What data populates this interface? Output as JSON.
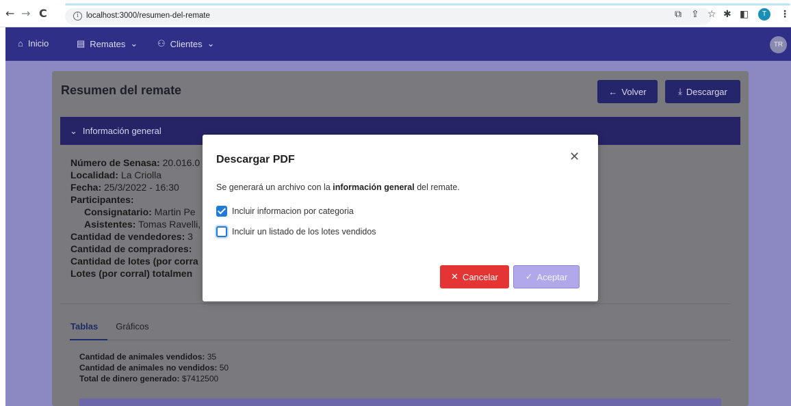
{
  "browser": {
    "url": "localhost:3000/resumen-del-remate",
    "back_icon": "←",
    "forward_icon": "→",
    "reload_icon": "C",
    "profile_initial": "T"
  },
  "navbar": {
    "items": [
      {
        "icon": "⌂",
        "label": "Inicio"
      },
      {
        "icon": "▤",
        "label": "Remates",
        "caret": "⌄"
      },
      {
        "icon": "⚇",
        "label": "Clientes",
        "caret": "⌄"
      }
    ],
    "avatar": "TR"
  },
  "page": {
    "title": "Resumen del remate",
    "back_button": "Volver",
    "download_button": "Descargar",
    "accordion_title": "Información general",
    "info": {
      "senasa_label": "Número de Senasa:",
      "senasa_value": "20.016.0",
      "localidad_label": "Localidad:",
      "localidad_value": "La Criolla",
      "fecha_label": "Fecha:",
      "fecha_value": "25/3/2022 - 16:30",
      "participantes_label": "Participantes:",
      "consignatario_label": "Consignatario:",
      "consignatario_value": "Martin Pe",
      "asistentes_label": "Asistentes:",
      "asistentes_value": "Tomas Ravelli,",
      "vendedores_label": "Cantidad de vendedores:",
      "vendedores_value": "3",
      "compradores_label": "Cantidad de compradores:",
      "compradores_value": "",
      "lotes_label": "Cantidad de lotes (por corra",
      "lotes_total_label": "Lotes (por corral) totalmen"
    },
    "tabs": [
      {
        "label": "Tablas"
      },
      {
        "label": "Gráficos"
      }
    ],
    "stats": {
      "vendidos_label": "Cantidad de animales vendidos:",
      "vendidos_value": "35",
      "no_vendidos_label": "Cantidad de animales no vendidos:",
      "no_vendidos_value": "50",
      "dinero_label": "Total de dinero generado:",
      "dinero_value": "$7412500"
    }
  },
  "modal": {
    "title": "Descargar PDF",
    "text_prefix": "Se generará un archivo con la ",
    "text_bold": "información general",
    "text_suffix": " del remate.",
    "options": [
      {
        "label": "Incluir informacion por categoria",
        "checked": true
      },
      {
        "label": "Incluir un listado de los lotes vendidos",
        "checked": false
      }
    ],
    "cancel": "Cancelar",
    "accept": "Aceptar"
  },
  "colors": {
    "navbar": "#2f2f87",
    "primary": "#1f7ad8",
    "danger": "#e53434",
    "accept_disabled": "#b0a8e8"
  }
}
